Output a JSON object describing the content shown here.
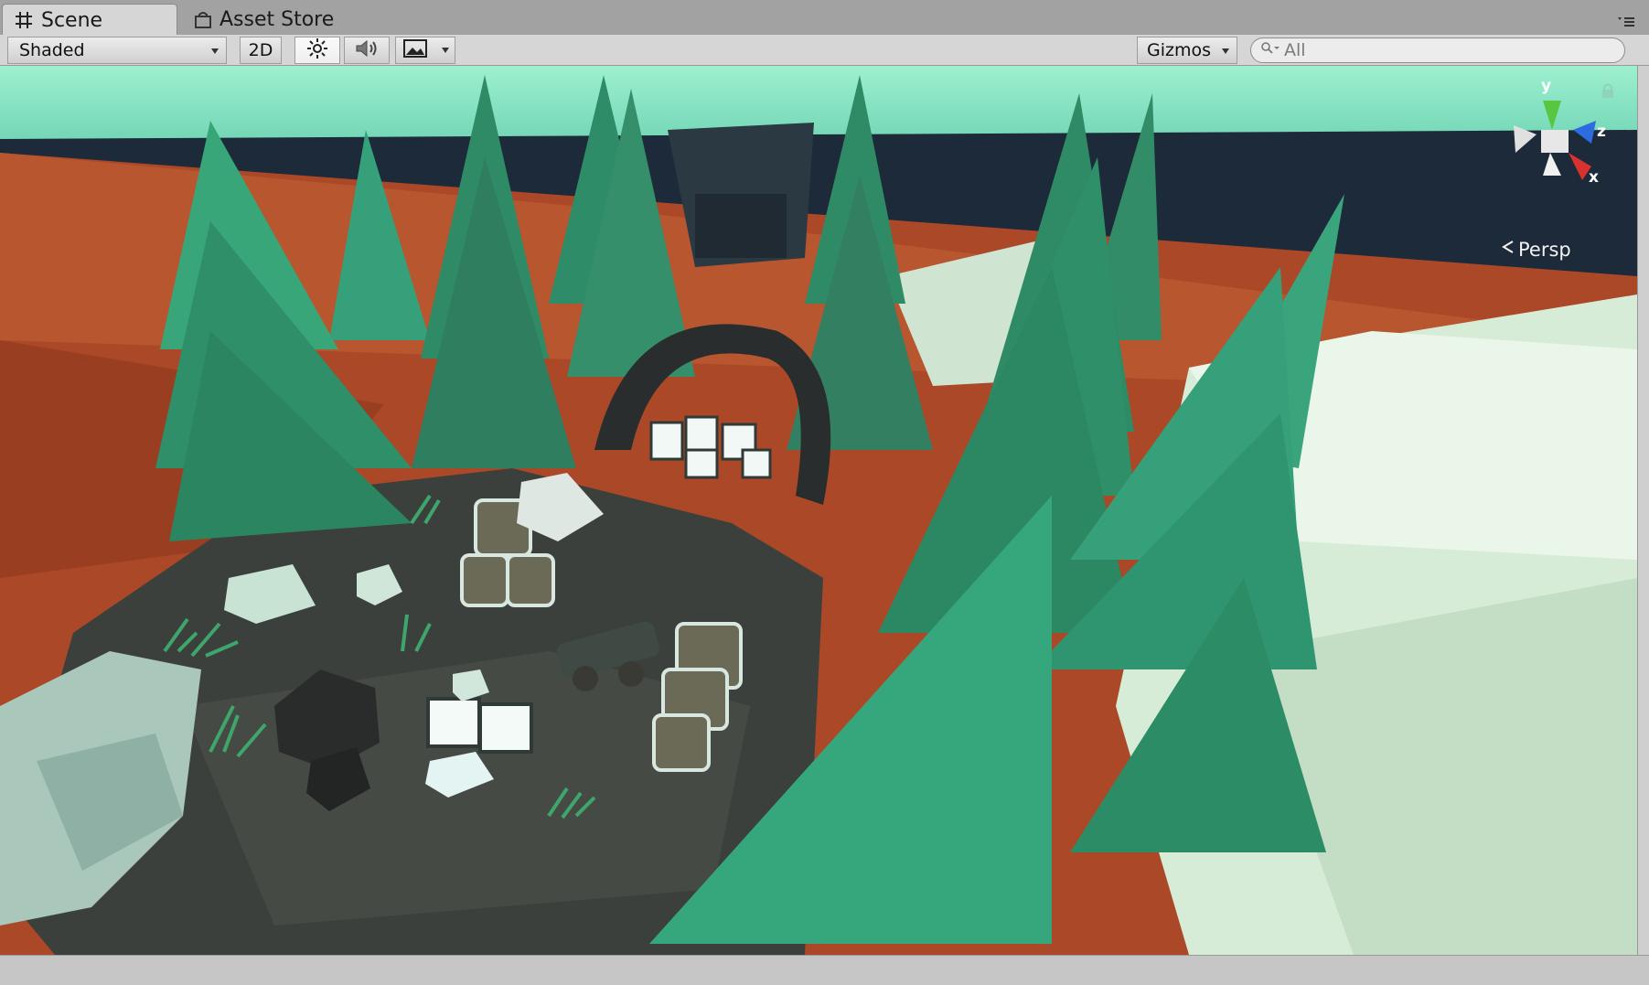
{
  "tabs": [
    {
      "label": "Scene",
      "icon": "grid-icon",
      "active": true
    },
    {
      "label": "Asset Store",
      "icon": "shopping-bag-icon",
      "active": false
    }
  ],
  "toolbar": {
    "shading_mode": "Shaded",
    "mode_2d_label": "2D",
    "lighting_icon": "sun-icon",
    "audio_icon": "speaker-icon",
    "effects_icon": "image-icon",
    "gizmos_label": "Gizmos",
    "search_placeholder": "All"
  },
  "viewport": {
    "projection_label": "Persp",
    "gizmo_axes": {
      "y": "y",
      "z": "z",
      "x": "x"
    },
    "colors": {
      "sky": "#8ee6c4",
      "ground": "#b04a2a",
      "water": "#1d2a3a",
      "tree": "#2f9a72",
      "rock": "#d9ecd9",
      "platform": "#3c403c"
    }
  }
}
